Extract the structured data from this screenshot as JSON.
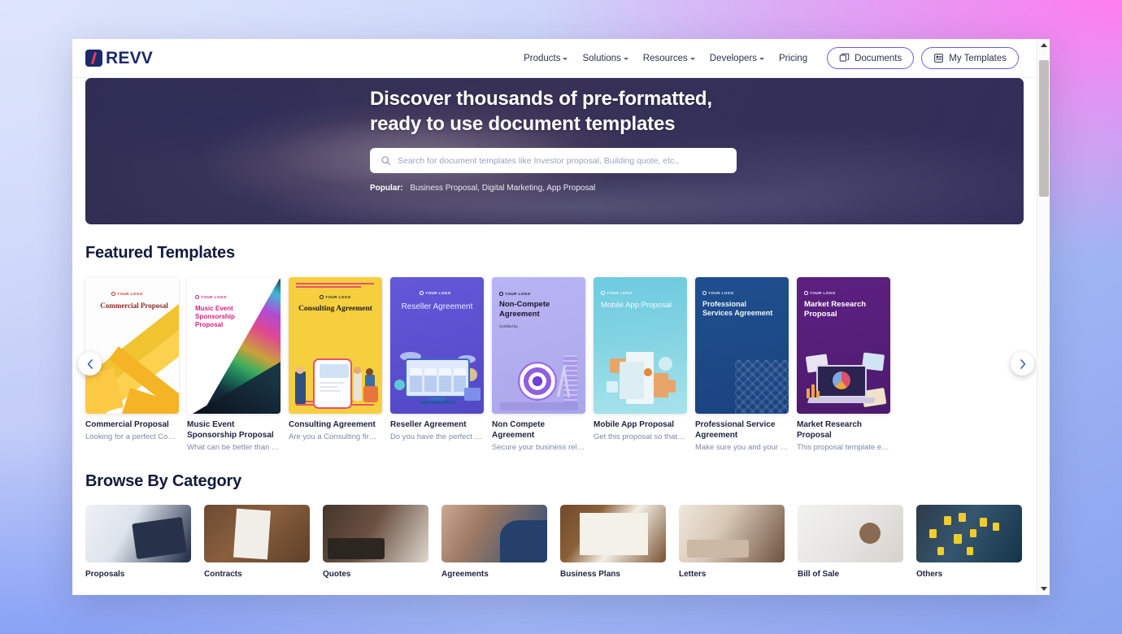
{
  "header": {
    "logo_text": "REVV",
    "nav_links": [
      {
        "label": "Products",
        "has_caret": true
      },
      {
        "label": "Solutions",
        "has_caret": true
      },
      {
        "label": "Resources",
        "has_caret": true
      },
      {
        "label": "Developers",
        "has_caret": true
      },
      {
        "label": "Pricing",
        "has_caret": false
      }
    ],
    "buttons": [
      {
        "label": "Documents",
        "icon": "documents-icon"
      },
      {
        "label": "My Templates",
        "icon": "templates-icon"
      }
    ]
  },
  "hero": {
    "title_line1": "Discover thousands of pre-formatted,",
    "title_line2": "ready to use document templates",
    "search_placeholder": "Search for document templates like Investor proposal, Building quote, etc.,",
    "search_value": "",
    "popular_label": "Popular:",
    "popular_items": "Business Proposal, Digital Marketing, App Proposal"
  },
  "featured": {
    "title": "Featured Templates",
    "prev_arrow": "‹",
    "next_arrow": "›",
    "cards": [
      {
        "name": "Commercial Proposal",
        "desc": "Looking for a perfect Comm...",
        "thumb_logo": "YOUR LOGO",
        "thumb_title": "Commercial Proposal"
      },
      {
        "name": "Music Event Sponsorship Proposal",
        "desc": "What can be better than a c...",
        "thumb_logo": "YOUR LOGO",
        "thumb_title": "Music Event Sponsorship Proposal"
      },
      {
        "name": "Consulting Agreement",
        "desc": "Are you a Consulting firm lo...",
        "thumb_logo": "YOUR LOGO",
        "thumb_title": "Consulting Agreement"
      },
      {
        "name": "Reseller Agreement",
        "desc": "Do you have the perfect res...",
        "thumb_logo": "YOUR LOGO",
        "thumb_title": "Reseller Agreement"
      },
      {
        "name": "Non Compete Agreement",
        "desc": "Secure your business relati...",
        "thumb_logo": "YOUR LOGO",
        "thumb_title": "Non-Compete Agreement"
      },
      {
        "name": "Mobile App Proposal",
        "desc": "Get this proposal so that yo...",
        "thumb_logo": "YOUR LOGO",
        "thumb_title": "Mobile App Proposal"
      },
      {
        "name": "Professional Service Agreement",
        "desc": "Make sure you and your ser...",
        "thumb_logo": "YOUR LOGO",
        "thumb_title": "Professional Services Agreement"
      },
      {
        "name": "Market Research Proposal",
        "desc": "This proposal template enc...",
        "thumb_logo": "YOUR LOGO",
        "thumb_title": "Market Research Proposal"
      }
    ]
  },
  "categories": {
    "title": "Browse By Category",
    "items": [
      {
        "label": "Proposals"
      },
      {
        "label": "Contracts"
      },
      {
        "label": "Quotes"
      },
      {
        "label": "Agreements"
      },
      {
        "label": "Business Plans"
      },
      {
        "label": "Letters"
      },
      {
        "label": "Bill of Sale"
      },
      {
        "label": "Others"
      }
    ]
  },
  "colors": {
    "brand_navy": "#1b2a6b",
    "brand_accent": "#e8385c",
    "button_outline": "#6b5ce7",
    "heading": "#131a3a",
    "muted_text": "#7e88a8"
  }
}
